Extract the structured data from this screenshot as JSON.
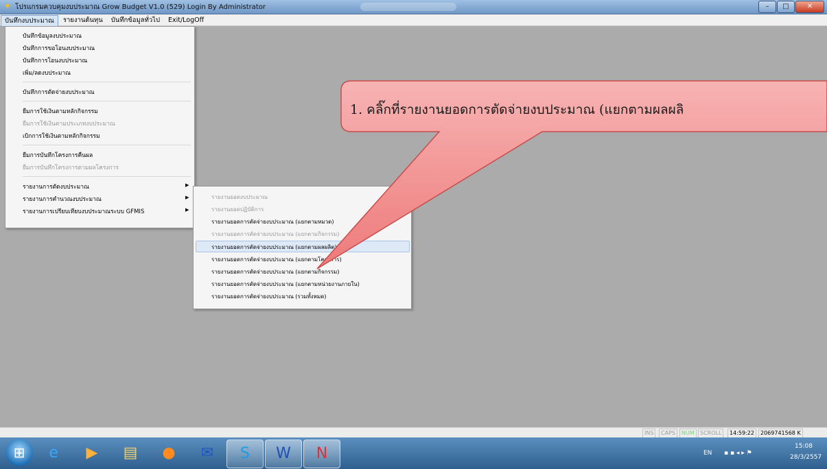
{
  "window": {
    "title": "โปรแกรมควบคุมงบประมาณ Grow Budget V1.0 (529) Login By Administrator",
    "minimize_label": "–",
    "maximize_label": "□",
    "close_label": "✕"
  },
  "menubar": {
    "items": [
      "บันทึกงบประมาณ",
      "รายงานต้นทุน",
      "บันทึกข้อมูลทั่วไป",
      "Exit/LogOff"
    ]
  },
  "dropdown": {
    "items": [
      "บันทึกข้อมูลงบประมาณ",
      "บันทึกการขอโอนงบประมาณ",
      "บันทึกการโอนงบประมาณ",
      "เพิ่ม/ลดงบประมาณ",
      "บันทึกการตัดจ่ายงบประมาณ",
      "ยืมการใช้เงินตามหลักกิจกรรม",
      "ยืมการใช้เงินตามประเภทงบประมาณ",
      "เบิกการใช้เงินตามหลักกิจกรรม",
      "ยืมการบันทึกโครงการคืนผล",
      "ยืมการบันทึกโครงการตามผลโครงการ",
      "รายงานการตัดงบประมาณ",
      "รายงานการคำนวณงบประมาณ",
      "รายงานการเปรียบเทียบงบประมาณระบบ GFMIS"
    ]
  },
  "submenu": {
    "items": [
      "รายงานยอดงบประมาณ",
      "รายงานยอดปฏิบัติการ",
      "รายงานยอดการตัดจ่ายงบประมาณ (แยกตามหมวด)",
      "รายงานยอดการตัดจ่ายงบประมาณ (แยกตามกิจกรรม)",
      "รายงานยอดการตัดจ่ายงบประมาณ (แยกตามผลผลิต)",
      "รายงานยอดการตัดจ่ายงบประมาณ (แยกตามโครงการ)",
      "รายงานยอดการตัดจ่ายงบประมาณ (แยกตามกิจกรรม)",
      "รายงานยอดการตัดจ่ายงบประมาณ (แยกตามหน่วยงานภายใน)",
      "รายงานยอดการตัดจ่ายงบประมาณ (รวมทั้งหมด)"
    ]
  },
  "callout": {
    "text": "1. คลิ๊กที่รายงานยอดการตัดจ่ายงบประมาณ (แยกตามผลผลิ"
  },
  "statusbar": {
    "ins": "INS",
    "caps": "CAPS",
    "num": "NUM",
    "scroll": "SCROLL",
    "time": "14:59:22",
    "memory": "2069741568 K"
  },
  "taskbar": {
    "icons": [
      "windows-start-icon",
      "internet-explorer-icon",
      "media-player-icon",
      "file-explorer-icon",
      "firefox-icon",
      "outlook-icon",
      "skype-icon",
      "word-icon",
      "grow-budget-app-icon"
    ],
    "tray": {
      "language": "EN",
      "time": "15:08",
      "date": "28/3/2557"
    }
  },
  "colors": {
    "callout_fill": "#f08a8a",
    "desktop_bg": "#ababab",
    "menu_highlight": "#dde9f7"
  }
}
